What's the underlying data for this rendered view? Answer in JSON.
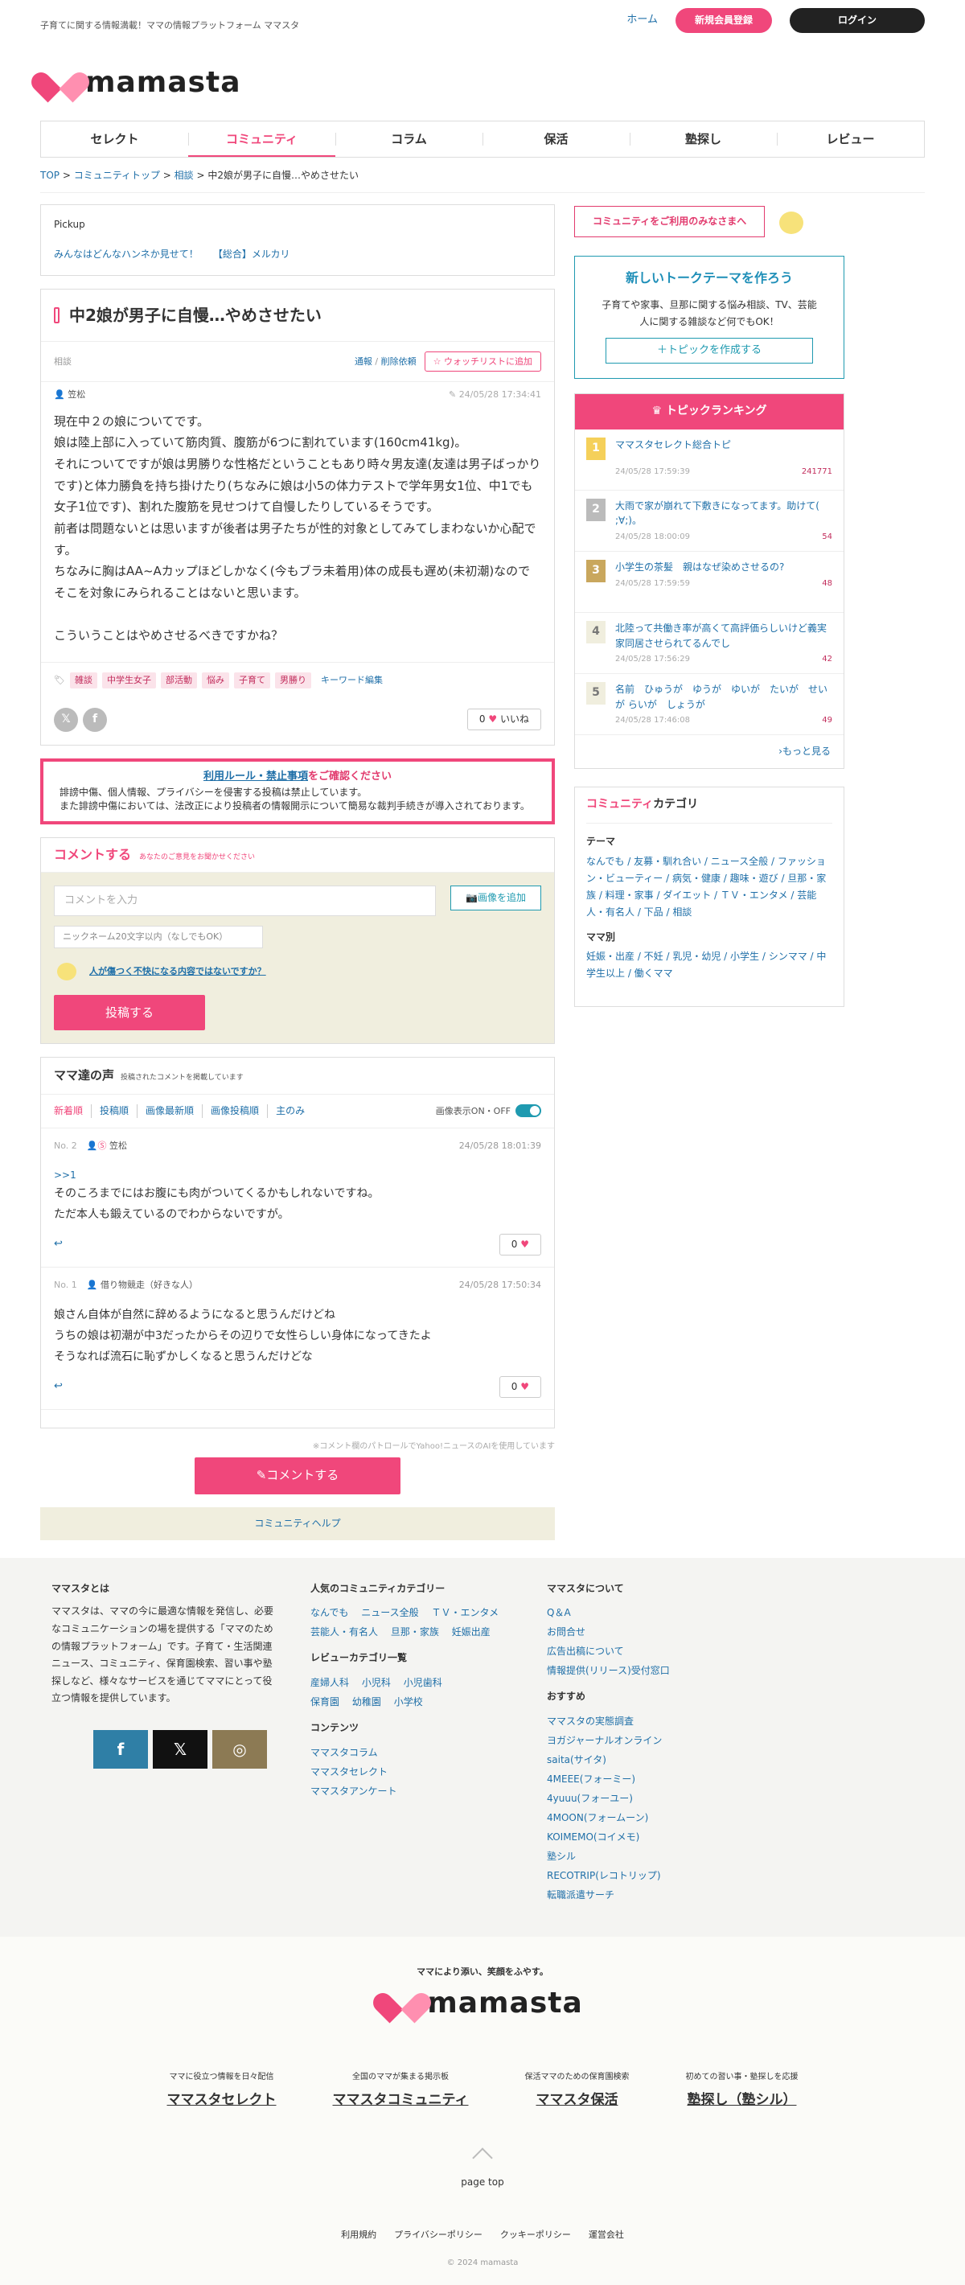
{
  "header": {
    "tagline": "子育てに関する情報満載！ママの情報プラットフォーム ママスタ",
    "home": "ホーム",
    "register": "新規会員登録",
    "login": "ログイン",
    "logo_text": "mamasta"
  },
  "nav": [
    "セレクト",
    "コミュニティ",
    "コラム",
    "保活",
    "塾探し",
    "レビュー"
  ],
  "breadcrumb": {
    "top": "TOP",
    "community": "コミュニティトップ",
    "cat": "相談",
    "current": "中2娘が男子に自慢…やめさせたい"
  },
  "pickup": {
    "title": "Pickup",
    "links": [
      "みんなはどんなハンネか見せて！",
      "【総合】メルカリ"
    ]
  },
  "topic": {
    "title": "中2娘が男子に自慢…やめさせたい",
    "category": "相談",
    "report": "通報",
    "delete": "削除依頼",
    "watchlist": "☆ ウォッチリストに追加",
    "user": "笠松",
    "date": "24/05/28 17:34:41",
    "body": [
      "現在中２の娘についてです。",
      "娘は陸上部に入っていて筋肉質、腹筋が6つに割れています(160cm41kg)。",
      "それについてですが娘は男勝りな性格だということもあり時々男友達(友達は男子ばっかりです)と体力勝負を持ち掛けたり(ちなみに娘は小5の体力テストで学年男女1位、中1でも女子1位です)、割れた腹筋を見せつけて自慢したりしているそうです。",
      "前者は問題ないとは思いますが後者は男子たちが性的対象としてみてしまわないか心配です。",
      "ちなみに胸はAA~Aカップほどしかなく(今もブラ未着用)体の成長も遅め(未初潮)なのでそこを対象にみられることはないと思います。",
      "",
      "こういうことはやめさせるべきですかね？"
    ],
    "tags": [
      "雑談",
      "中学生女子",
      "部活動",
      "悩み",
      "子育て",
      "男勝り"
    ],
    "kw_edit": "キーワード編集",
    "likes": "0",
    "like_label": "いいね"
  },
  "rules": {
    "title_a": "利用ルール・禁止事項",
    "title_b": "をご確認ください",
    "l1": "誹謗中傷、個人情報、プライバシーを侵害する投稿は禁止しています。",
    "l2": "また誹謗中傷においては、法改正により投稿者の情報開示について簡易な裁判手続きが導入されております。"
  },
  "comment_form": {
    "title": "コメントする",
    "sub": "あなたのご意見をお聞かせください",
    "placeholder": "コメントを入力",
    "image_btn": "画像を追加",
    "nick_placeholder": "ニックネーム20文字以内（なしでもOK）",
    "warn": "人が傷つく不快になる内容ではないですか？",
    "submit": "投稿する"
  },
  "comments_list": {
    "title": "ママ達の声",
    "sub": "投稿されたコメントを掲載しています",
    "sort": [
      "新着順",
      "投稿順",
      "画像最新順",
      "画像投稿順",
      "主のみ"
    ],
    "toggle": "画像表示ON・OFF",
    "items": [
      {
        "no": "No. 2",
        "name": "笠松",
        "date": "24/05/28 18:01:39",
        "ref": ">>1",
        "text": [
          "そのころまでにはお腹にも肉がついてくるかもしれないですね。",
          "ただ本人も鍛えているのでわからないですが。"
        ],
        "likes": "0"
      },
      {
        "no": "No. 1",
        "name": "借り物競走（好きな人）",
        "date": "24/05/28 17:50:34",
        "ref": "",
        "text": [
          "娘さん自体が自然に辞めるようになると思うんだけどね",
          "うちの娘は初潮が中3だったからその辺りで女性らしい身体になってきたよ",
          "そうなれば流石に恥ずかしくなると思うんだけどな"
        ],
        "likes": "0"
      }
    ]
  },
  "note": "※コメント欄のパトロールでYahoo!ニュースのAIを使用しています",
  "comment_btn": "コメントする",
  "help": "コミュニティヘルプ",
  "side": {
    "banner": "コミュニティをご利用のみなさまへ",
    "newtalk_title": "新しいトークテーマを作ろう",
    "newtalk_text": "子育てや家事、旦那に関する悩み相談、TV、芸能人に関する雑談など何でもOK！",
    "newtalk_btn": "トピックを作成する",
    "ranking_title": "トピックランキング",
    "ranking": [
      {
        "n": "1",
        "title": "ママスタセレクト総合トピ",
        "date": "24/05/28 17:59:39",
        "count": "241771"
      },
      {
        "n": "2",
        "title": "大雨で家が崩れて下敷きになってます。助けて( ;∀;)。",
        "date": "24/05/28 18:00:09",
        "count": "54"
      },
      {
        "n": "3",
        "title": "小学生の茶髪　親はなぜ染めさせるの?",
        "date": "24/05/28 17:59:59",
        "count": "48"
      },
      {
        "n": "4",
        "title": "北陸って共働き率が高くて高評価らしいけど義実家同居させられてるんでし",
        "date": "24/05/28 17:56:29",
        "count": "42"
      },
      {
        "n": "5",
        "title": "名前　ひゅうが　ゆうが　ゆいが　たいが　せいが らいが　しょうが",
        "date": "24/05/28 17:46:08",
        "count": "49"
      }
    ],
    "more": "もっと見る",
    "cat_title_a": "コミュニティ",
    "cat_title_b": "カテゴリ",
    "theme_h": "テーマ",
    "theme": "なんでも / 友募・馴れ合い / ニュース全般 / ファッション・ビューティー / 病気・健康 / 趣味・遊び / 旦那・家族 / 料理・家事 / ダイエット / ＴＶ・エンタメ / 芸能人・有名人 / 下品 / 相談",
    "mama_h": "ママ別",
    "mama": "妊娠・出産 / 不妊 / 乳児・幼児 / 小学生 / シンママ / 中学生以上 / 働くママ"
  },
  "footer": {
    "about_h": "ママスタとは",
    "about": "ママスタは、ママの今に最適な情報を発信し、必要なコミュニケーションの場を提供する「ママのための情報プラットフォーム」です。子育て・生活関連ニュース、コミュニティ、保育園検索、習い事や塾探しなど、様々なサービスを通じてママにとって役立つ情報を提供しています。",
    "popular_h": "人気のコミュニティカテゴリー",
    "popular": [
      "なんでも",
      "ニュース全般",
      "ＴＶ・エンタメ",
      "芸能人・有名人",
      "旦那・家族",
      "妊娠出産"
    ],
    "review_h": "レビューカテゴリ一覧",
    "review": [
      "産婦人科",
      "小児科",
      "小児歯科",
      "保育園",
      "幼稚園",
      "小学校"
    ],
    "contents_h": "コンテンツ",
    "contents": [
      "ママスタコラム",
      "ママスタセレクト",
      "ママスタアンケート"
    ],
    "mamasta_h": "ママスタについて",
    "mamasta": [
      "Q＆A",
      "お問合せ",
      "広告出稿について",
      "情報提供(リリース)受付窓口"
    ],
    "recommend_h": "おすすめ",
    "recommend": [
      "ママスタの実態調査",
      "ヨガジャーナルオンライン",
      "saita(サイタ)",
      "4MEEE(フォーミー)",
      "4yuuu(フォーユー)",
      "4MOON(フォームーン)",
      "KOIMEMO(コイメモ)",
      "塾シル",
      "RECOTRIP(レコトリップ)",
      "転職派遣サーチ"
    ],
    "tagline": "ママにより添い、笑顔をふやす。",
    "services": [
      {
        "sub": "ママに役立つ情報を日々配信",
        "name": "ママスタセレクト"
      },
      {
        "sub": "全国のママが集まる掲示板",
        "name": "ママスタコミュニティ"
      },
      {
        "sub": "保活ママのための保育園検索",
        "name": "ママスタ保活"
      },
      {
        "sub": "初めての習い事・塾探しを応援",
        "name": "塾探し（塾シル）"
      }
    ],
    "pagetop": "page top",
    "links": [
      "利用規約",
      "プライバシーポリシー",
      "クッキーポリシー",
      "運営会社"
    ],
    "copy": "© 2024 mamasta"
  }
}
